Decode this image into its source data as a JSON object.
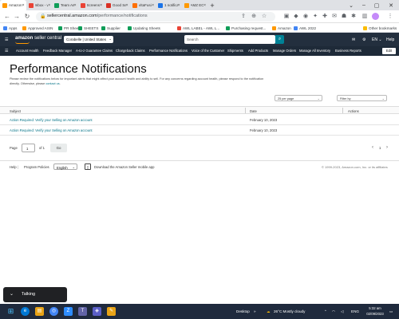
{
  "browser": {
    "tabs": [
      {
        "title": "Amazon",
        "color": "#ff9900",
        "active": true
      },
      {
        "title": "Inbox - vaice",
        "color": "#ea4335"
      },
      {
        "title": "Team Amaz",
        "color": "#0f9d58"
      },
      {
        "title": "Screensho",
        "color": "#ea4335"
      },
      {
        "title": "Good Searc",
        "color": "#d93025"
      },
      {
        "title": "VitaFusion",
        "color": "#ff6f00"
      },
      {
        "title": "1 notificati",
        "color": "#1a73e8"
      },
      {
        "title": "AMZ EOD",
        "color": "#ff9900"
      }
    ],
    "new_tab": "+",
    "window_controls": [
      "⌄",
      "–",
      "▢",
      "✕"
    ],
    "url_domain": "sellercentral.amazon.com",
    "url_path": "/performance/notifications",
    "bookmarks": [
      {
        "label": "Apps",
        "color": "#4285f4"
      },
      {
        "label": "Approved ASIN",
        "color": "#ff9900"
      },
      {
        "label": "PR Sheet",
        "color": "#0f9d58"
      },
      {
        "label": "SHEETS",
        "color": "#0f9d58"
      },
      {
        "label": "Supplier",
        "color": "#0f9d58"
      },
      {
        "label": "Updating Sheets",
        "color": "#0f9d58"
      },
      {
        "label": "AWL LABEL - AWL L...",
        "color": "#ea4335"
      },
      {
        "label": "Purchasing request...",
        "color": "#0f9d58"
      },
      {
        "label": "Amazon",
        "color": "#ff9900"
      },
      {
        "label": "AWL 2022",
        "color": "#4285f4"
      }
    ],
    "other_bookmarks": "Other bookmarks"
  },
  "seller_central": {
    "logo_bold": "amazon",
    "logo_thin": " seller central",
    "marketplace": "Corabelle | United States",
    "search_placeholder": "Search",
    "language": "EN",
    "help": "Help",
    "nav": [
      "Account Health",
      "Feedback Manager",
      "A-to-z Guarantee Claims",
      "Chargeback Claims",
      "Performance Notifications",
      "Voice of the Customer",
      "Shipments",
      "Add Products",
      "Manage Orders",
      "Manage All Inventory",
      "Business Reports"
    ],
    "edit": "Edit"
  },
  "page": {
    "title": "Performance Notifications",
    "description": "Please review the notifications below for important alerts that might affect your account health and ability to sell. For any concerns regarding account health, please respond to the notification directly. Otherwise, please",
    "contact_link": "contact us",
    "per_page": "25 per page",
    "filter": "Filter by",
    "columns": {
      "subject": "Subject",
      "date": "Date",
      "actions": "Actions"
    },
    "rows": [
      {
        "subject": "Action Required: Verify your Selling on Amazon account",
        "date": "February 10, 2023"
      },
      {
        "subject": "Action Required: Verify your Selling on Amazon account",
        "date": "February 10, 2023"
      }
    ],
    "pager": {
      "page_label": "Page",
      "page_value": "1",
      "of_label": "of 1",
      "go": "Go",
      "current": "1"
    }
  },
  "footer": {
    "help": "Help",
    "program_policies": "Program Policies",
    "language": "English",
    "app_text": "Download the Amazon Seller mobile app",
    "copyright": "© 1999-2023, Amazon.com, Inc. or its affiliates"
  },
  "talking": "Talking",
  "taskbar": {
    "desktop": "Desktop",
    "weather": "26°C  Mostly cloudy",
    "lang": "ENG",
    "time": "5:32 am",
    "date": "02/09/2023"
  }
}
